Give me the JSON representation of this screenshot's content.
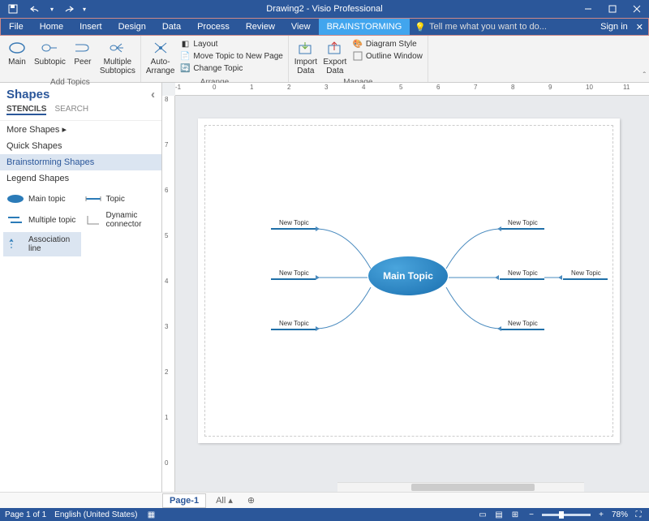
{
  "titlebar": {
    "doc_title": "Drawing2 - Visio Professional"
  },
  "qat": {
    "save": "save-icon",
    "undo": "undo-icon",
    "redo": "redo-icon"
  },
  "tabs": {
    "file": "File",
    "home": "Home",
    "insert": "Insert",
    "design": "Design",
    "data": "Data",
    "process": "Process",
    "review": "Review",
    "view": "View",
    "brainstorming": "BRAINSTORMING",
    "sign_in": "Sign in",
    "tell_me": "Tell me what you want to do..."
  },
  "ribbon": {
    "add_topics": {
      "label": "Add Topics",
      "main": "Main",
      "subtopic": "Subtopic",
      "peer": "Peer",
      "multiple": "Multiple\nSubtopics"
    },
    "arrange": {
      "label": "Arrange",
      "auto_arrange": "Auto-\nArrange",
      "layout": "Layout",
      "move_new_page": "Move Topic to New Page",
      "change_topic": "Change Topic"
    },
    "manage": {
      "label": "Manage",
      "import": "Import\nData",
      "export": "Export\nData",
      "diagram_style": "Diagram Style",
      "outline_window": "Outline Window"
    }
  },
  "shapes_pane": {
    "title": "Shapes",
    "tab_stencils": "STENCILS",
    "tab_search": "SEARCH",
    "more_shapes": "More Shapes",
    "quick_shapes": "Quick Shapes",
    "cat_brainstorming": "Brainstorming Shapes",
    "cat_legend": "Legend Shapes",
    "items": {
      "main_topic": "Main topic",
      "topic": "Topic",
      "multiple_topic": "Multiple topic",
      "dynamic_connector": "Dynamic connector",
      "association_line": "Association line"
    }
  },
  "diagram": {
    "main_topic": "Main Topic",
    "new_topic": "New Topic"
  },
  "ruler_h": [
    "-1",
    "0",
    "1",
    "2",
    "3",
    "4",
    "5",
    "6",
    "7",
    "8",
    "9",
    "10",
    "11"
  ],
  "ruler_v": [
    "8",
    "7",
    "6",
    "5",
    "4",
    "3",
    "2",
    "1",
    "0"
  ],
  "page_tabs": {
    "page1": "Page-1",
    "all": "All"
  },
  "statusbar": {
    "page_info": "Page 1 of 1",
    "language": "English (United States)",
    "zoom": "78%"
  }
}
